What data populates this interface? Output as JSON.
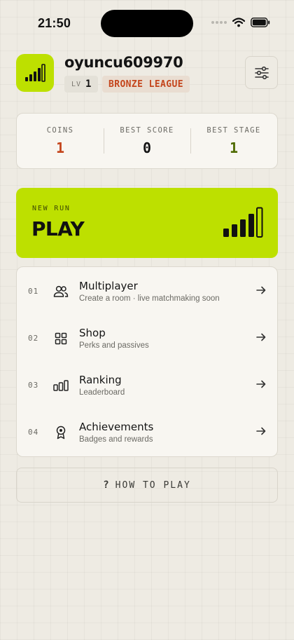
{
  "status_bar": {
    "time": "21:50"
  },
  "profile": {
    "username": "oyuncu609970",
    "level_prefix": "LV",
    "level_value": "1",
    "league": "BRONZE LEAGUE"
  },
  "stats": [
    {
      "label": "COINS",
      "value": "1",
      "color": "#c4451c"
    },
    {
      "label": "BEST SCORE",
      "value": "0",
      "color": "#141414"
    },
    {
      "label": "BEST STAGE",
      "value": "1",
      "color": "#4e6a00"
    }
  ],
  "play": {
    "kicker": "NEW RUN",
    "title": "PLAY"
  },
  "menu": [
    {
      "index": "01",
      "title": "Multiplayer",
      "subtitle": "Create a room · live matchmaking soon",
      "icon": "users-icon"
    },
    {
      "index": "02",
      "title": "Shop",
      "subtitle": "Perks and passives",
      "icon": "grid-icon"
    },
    {
      "index": "03",
      "title": "Ranking",
      "subtitle": "Leaderboard",
      "icon": "bars-icon"
    },
    {
      "index": "04",
      "title": "Achievements",
      "subtitle": "Badges and rewards",
      "icon": "award-icon"
    }
  ],
  "how_to_play": {
    "icon": "?",
    "label": "HOW TO PLAY"
  },
  "colors": {
    "accent": "#bde000",
    "league": "#c4451c",
    "background": "#eeebe3"
  }
}
